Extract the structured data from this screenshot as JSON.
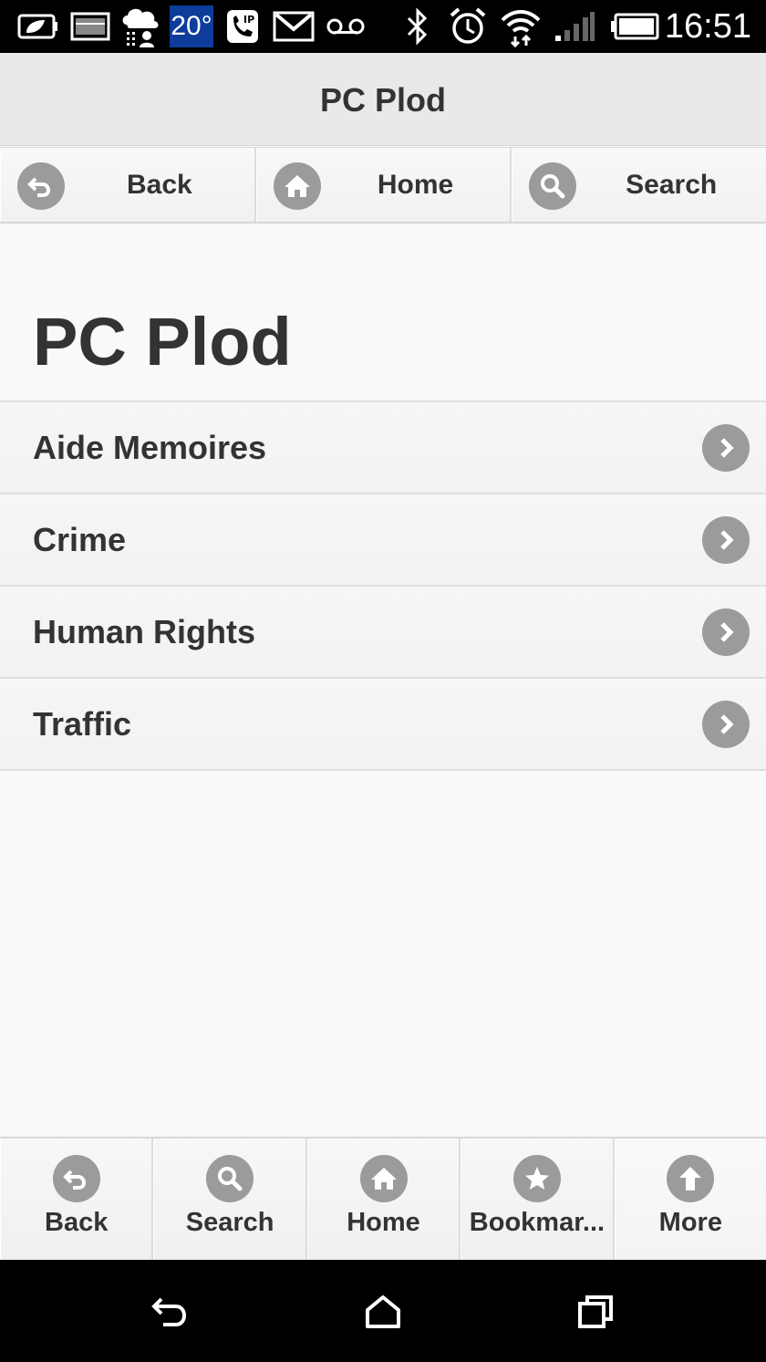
{
  "status_bar": {
    "temperature": "20°",
    "time": "16:51",
    "icons": [
      "battery-saver-icon",
      "image-icon",
      "weather-rain-icon",
      "phone-ip-icon",
      "gmail-icon",
      "voicemail-icon",
      "bluetooth-icon",
      "alarm-icon",
      "wifi-icon",
      "signal-icon",
      "battery-icon"
    ]
  },
  "header": {
    "title": "PC Plod"
  },
  "top_nav": {
    "back": {
      "label": "Back",
      "icon": "back-arrow-icon"
    },
    "home": {
      "label": "Home",
      "icon": "home-icon"
    },
    "search": {
      "label": "Search",
      "icon": "search-icon"
    }
  },
  "page": {
    "heading": "PC Plod",
    "items": [
      {
        "label": "Aide Memoires",
        "icon": "chevron-right-icon"
      },
      {
        "label": "Crime",
        "icon": "chevron-right-icon"
      },
      {
        "label": "Human Rights",
        "icon": "chevron-right-icon"
      },
      {
        "label": "Traffic",
        "icon": "chevron-right-icon"
      }
    ]
  },
  "bottom_bar": {
    "back": {
      "label": "Back",
      "icon": "back-arrow-icon"
    },
    "search": {
      "label": "Search",
      "icon": "search-icon"
    },
    "home": {
      "label": "Home",
      "icon": "home-icon"
    },
    "bookmarks": {
      "label": "Bookmar...",
      "icon": "star-icon"
    },
    "more": {
      "label": "More",
      "icon": "arrow-up-icon"
    }
  },
  "android_nav": [
    "system-back-icon",
    "system-home-icon",
    "system-recents-icon"
  ],
  "colors": {
    "status_bar_bg": "#000000",
    "header_bg": "#e9e9e9",
    "page_bg": "#f9f9f9",
    "icon_circle": "#9b9b9b",
    "text": "#333333",
    "temperature_badge": "#0d3c9b"
  }
}
